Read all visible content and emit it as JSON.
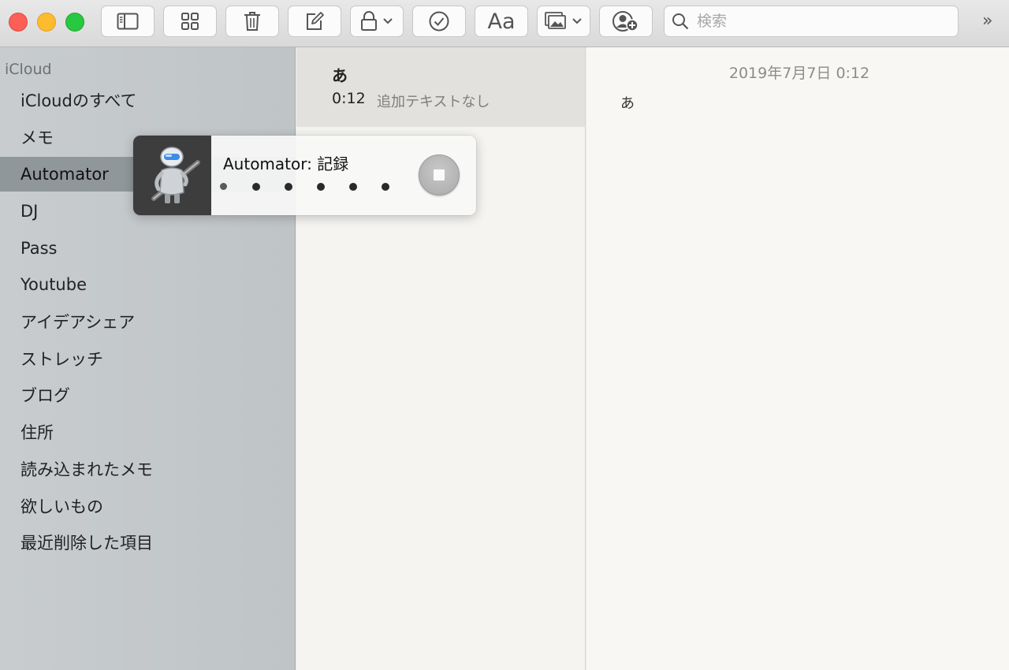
{
  "toolbar": {
    "window_controls": [
      "close",
      "minimize",
      "zoom"
    ],
    "buttons": [
      {
        "icon": "sidebar-icon"
      },
      {
        "icon": "gallery-grid-icon"
      },
      {
        "icon": "trash-icon"
      },
      {
        "icon": "compose-icon"
      },
      {
        "icon": "lock-icon",
        "has_dropdown": true
      },
      {
        "icon": "checklist-icon"
      },
      {
        "label": "Aa",
        "icon": "format-icon"
      },
      {
        "icon": "media-icon",
        "has_dropdown": true
      },
      {
        "icon": "add-people-icon"
      }
    ],
    "format_label": "Aa",
    "search": {
      "placeholder": "検索",
      "value": ""
    },
    "overflow_label": "»"
  },
  "sidebar": {
    "section": "iCloud",
    "folders": [
      {
        "label": "iCloudのすべて",
        "selected": false
      },
      {
        "label": "メモ",
        "selected": false
      },
      {
        "label": "Automator",
        "selected": true
      },
      {
        "label": "DJ",
        "selected": false
      },
      {
        "label": "Pass",
        "selected": false
      },
      {
        "label": "Youtube",
        "selected": false
      },
      {
        "label": "アイデアシェア",
        "selected": false
      },
      {
        "label": "ストレッチ",
        "selected": false
      },
      {
        "label": "ブログ",
        "selected": false
      },
      {
        "label": "住所",
        "selected": false
      },
      {
        "label": "読み込まれたメモ",
        "selected": false
      },
      {
        "label": "欲しいもの",
        "selected": false
      },
      {
        "label": "最近削除した項目",
        "selected": false
      }
    ]
  },
  "notes": [
    {
      "title": "あ",
      "time": "0:12",
      "preview": "追加テキストなし",
      "selected": true
    }
  ],
  "editor": {
    "date": "2019年7月7日 0:12",
    "body": "あ"
  },
  "automator_hud": {
    "title": "Automator: 記録",
    "icon": "automator-robot-icon",
    "stop_icon": "stop-icon",
    "dot_count": 6
  },
  "colors": {
    "sidebar_bg": "#c4c8ca",
    "sidebar_selected": "#8f979b",
    "list_selected": "#e2e1de",
    "close": "#fc5f57",
    "minimize": "#fdbc2e",
    "zoom": "#28c840"
  }
}
